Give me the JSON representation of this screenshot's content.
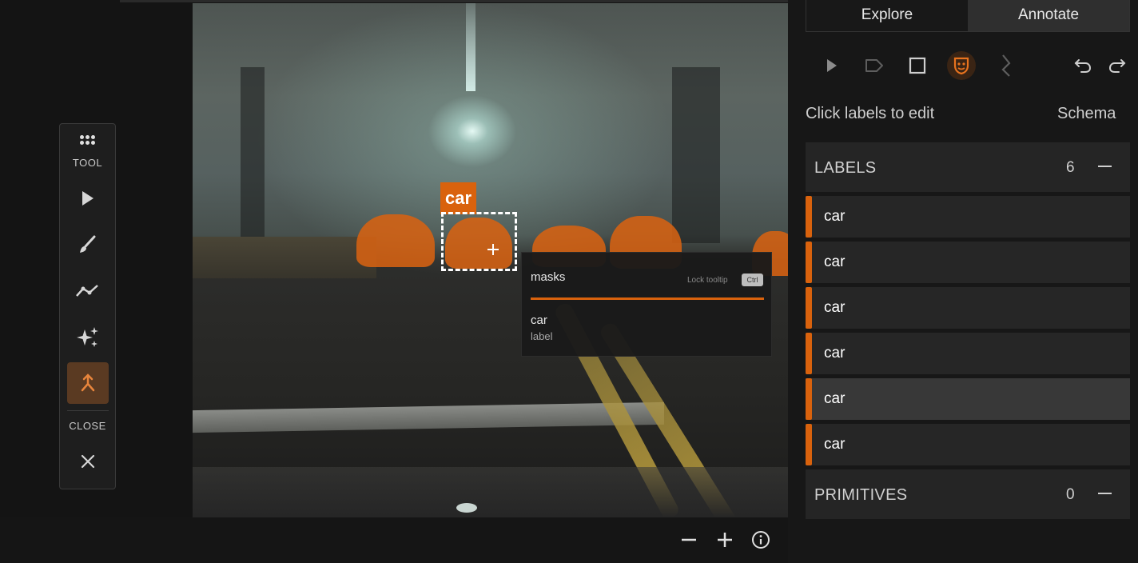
{
  "colors": {
    "accent": "#d9620d",
    "panel_bg": "#171717",
    "row_bg": "#262626"
  },
  "canvas": {
    "overlay_label": "car",
    "tooltip": {
      "field": "masks",
      "lock_hint": "Lock tooltip",
      "lock_key": "Ctrl",
      "value": "car",
      "key": "label"
    }
  },
  "tool_palette": {
    "heading": "TOOL",
    "tools": [
      {
        "icon": "cursor-arrow-icon"
      },
      {
        "icon": "brush-icon"
      },
      {
        "icon": "polyline-icon"
      },
      {
        "icon": "sparkles-icon"
      },
      {
        "icon": "merge-arrow-icon",
        "active": true
      }
    ],
    "close_label": "CLOSE",
    "close_icon": "close-icon"
  },
  "viewer_controls": {
    "zoom_out_icon": "minus-icon",
    "zoom_in_icon": "plus-icon",
    "info_icon": "info-icon"
  },
  "panel": {
    "tabs": [
      {
        "label": "Explore",
        "selected": false
      },
      {
        "label": "Annotate",
        "selected": true
      }
    ],
    "annotate_tools": [
      {
        "icon": "cursor-arrow-icon"
      },
      {
        "icon": "tag-icon"
      },
      {
        "icon": "square-icon"
      },
      {
        "icon": "mask-icon",
        "active": true
      },
      {
        "icon": "polyline-icon"
      }
    ],
    "history": {
      "undo_icon": "undo-icon",
      "redo_icon": "redo-icon"
    },
    "hint": "Click labels to edit",
    "schema_link": "Schema",
    "labels_section": {
      "title": "LABELS",
      "count": "6",
      "items": [
        {
          "label": "car"
        },
        {
          "label": "car"
        },
        {
          "label": "car"
        },
        {
          "label": "car"
        },
        {
          "label": "car",
          "hovered": true
        },
        {
          "label": "car"
        }
      ]
    },
    "primitives_section": {
      "title": "PRIMITIVES",
      "count": "0"
    }
  }
}
